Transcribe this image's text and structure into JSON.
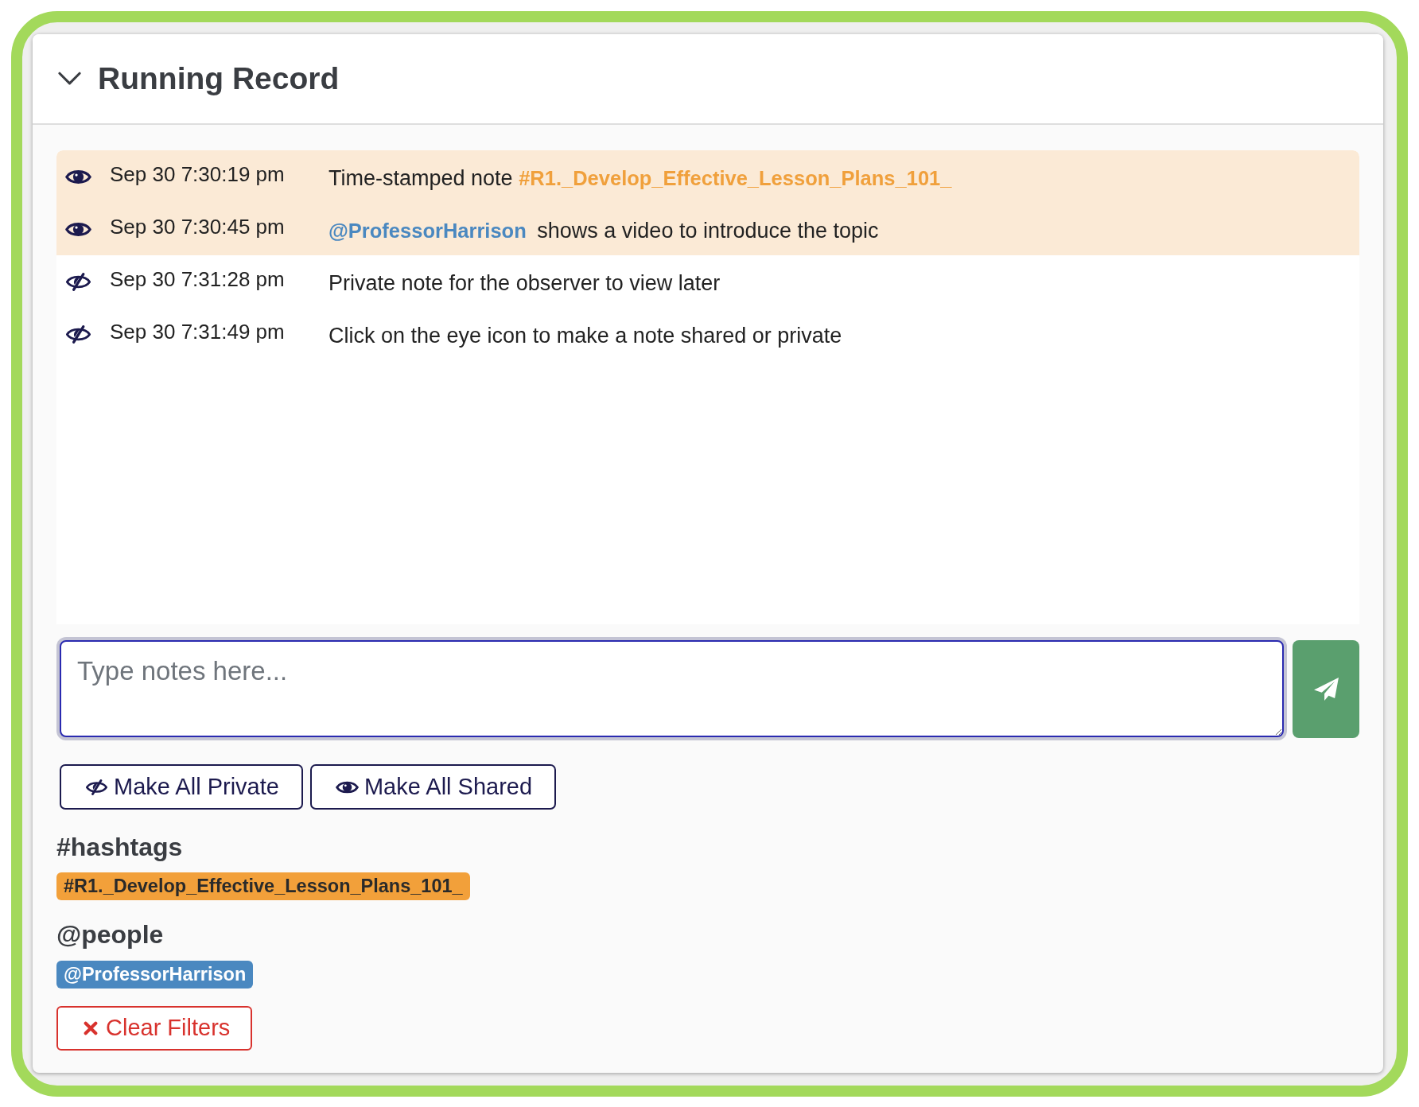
{
  "panel": {
    "title": "Running Record",
    "expanded": true
  },
  "notes": [
    {
      "time": "Sep 30 7:30:19 pm",
      "shared": true,
      "highlighted": true,
      "parts": [
        {
          "kind": "text",
          "text": "Time-stamped note"
        },
        {
          "kind": "hashtag",
          "text": "#R1._Develop_Effective_Lesson_Plans_101_"
        }
      ]
    },
    {
      "time": "Sep 30 7:30:45 pm",
      "shared": true,
      "highlighted": true,
      "parts": [
        {
          "kind": "mention",
          "text": "@ProfessorHarrison"
        },
        {
          "kind": "text",
          "text": "shows a video to introduce the topic"
        }
      ]
    },
    {
      "time": "Sep 30 7:31:28 pm",
      "shared": false,
      "highlighted": false,
      "parts": [
        {
          "kind": "text",
          "text": "Private note for the observer to view later"
        }
      ]
    },
    {
      "time": "Sep 30 7:31:49 pm",
      "shared": false,
      "highlighted": false,
      "parts": [
        {
          "kind": "text",
          "text": "Click on the eye icon to make a note shared or private"
        }
      ]
    }
  ],
  "composer": {
    "placeholder": "Type notes here...",
    "focused": true
  },
  "bulk_actions": [
    {
      "kind": "private",
      "label": "Make All Private"
    },
    {
      "kind": "shared",
      "label": "Make All Shared"
    }
  ],
  "filter_groups": [
    {
      "kind": "hashtag",
      "heading": "#hashtags",
      "tags": [
        "#R1._Develop_Effective_Lesson_Plans_101_"
      ]
    },
    {
      "kind": "person",
      "heading": "@people",
      "tags": [
        "@ProfessorHarrison"
      ]
    }
  ],
  "clear_filters": {
    "label": "Clear Filters"
  }
}
